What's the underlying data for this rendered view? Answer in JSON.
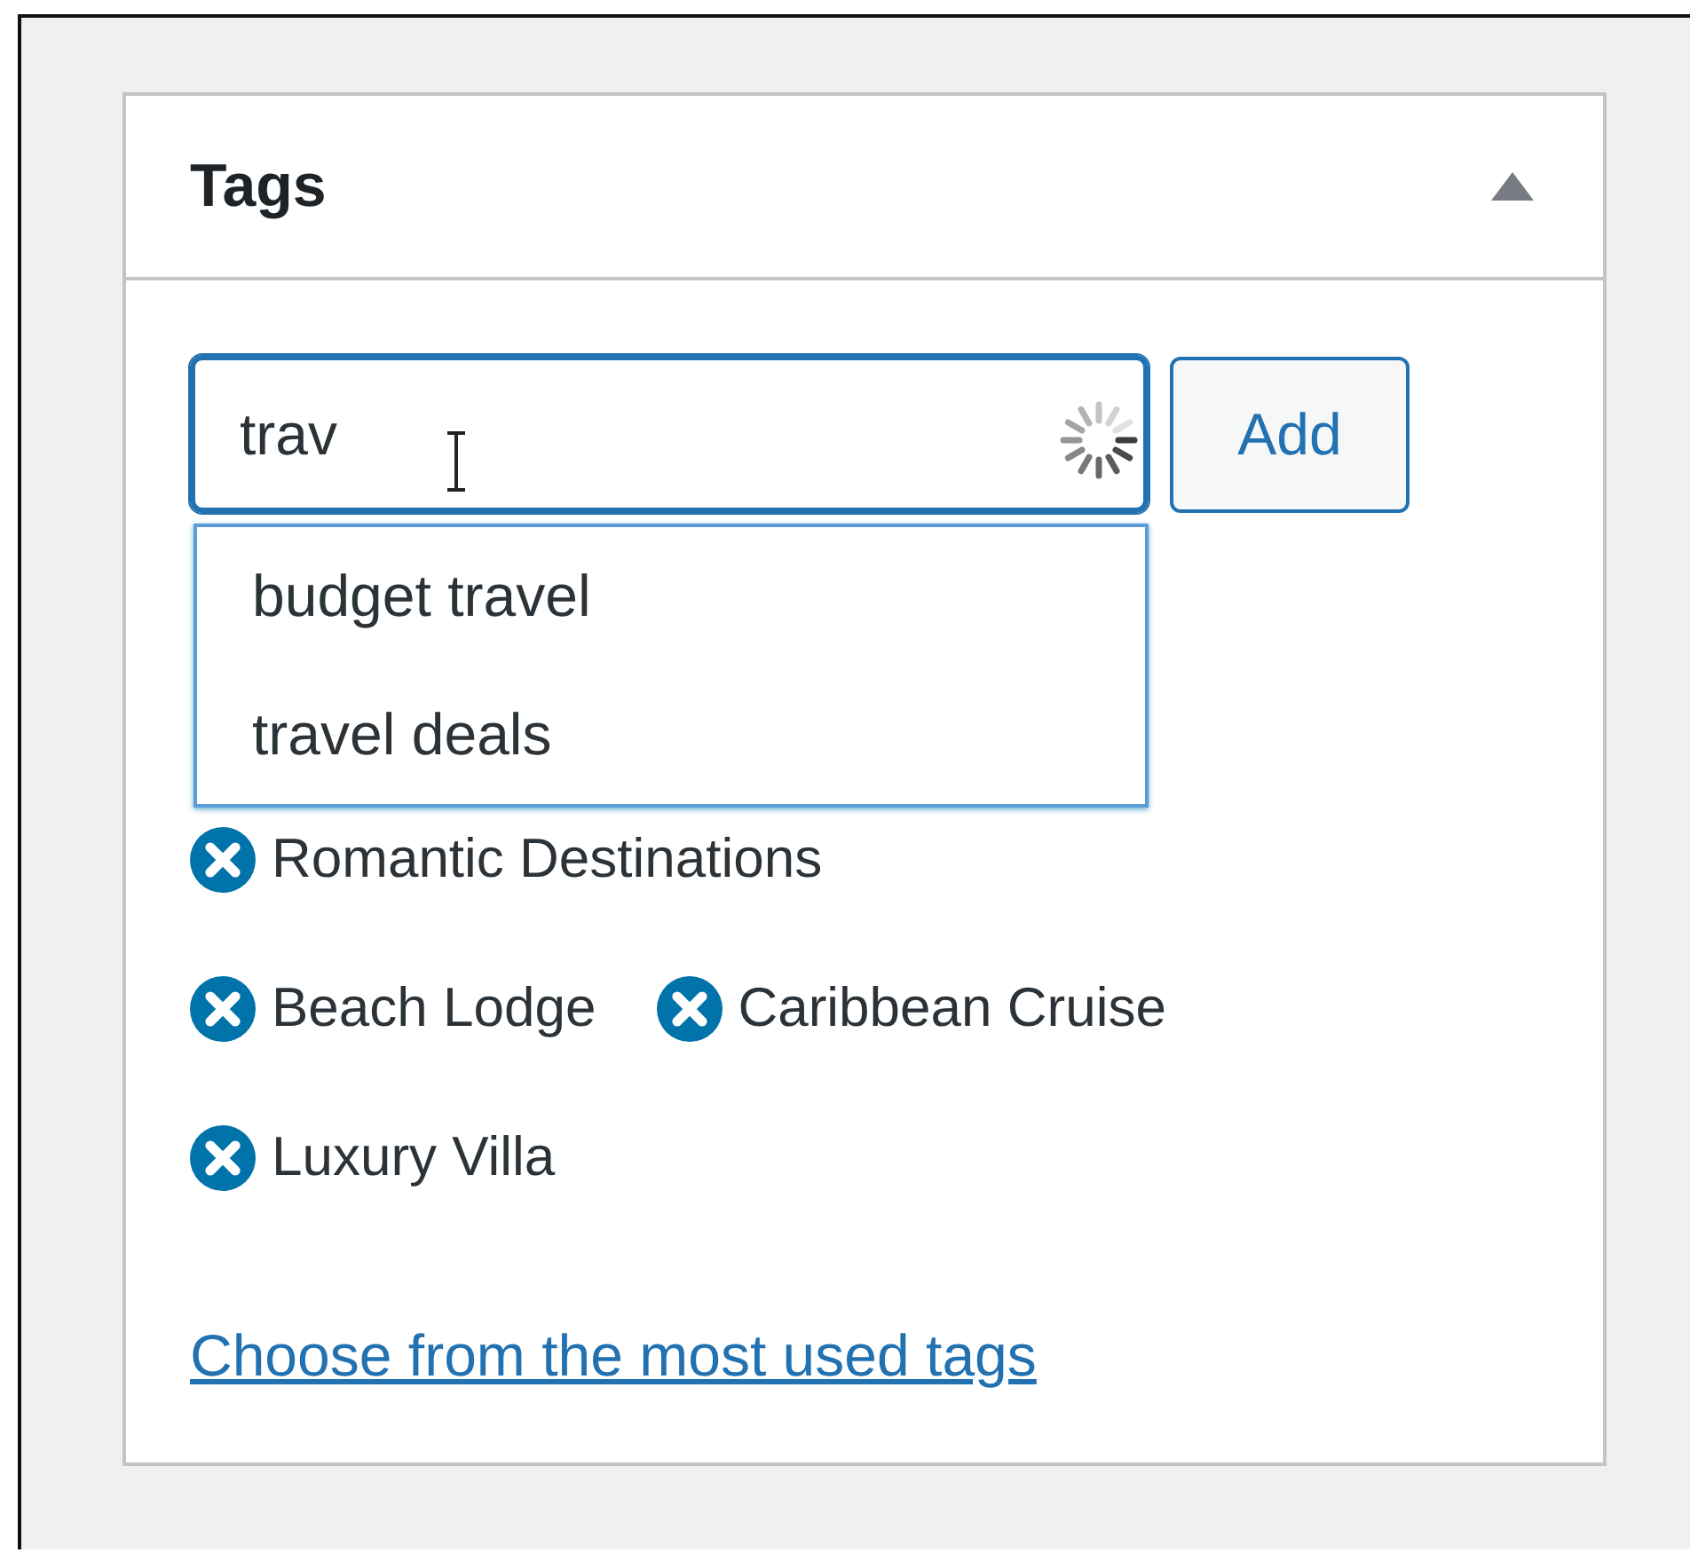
{
  "panel": {
    "title": "Tags",
    "expanded": true
  },
  "tag_input": {
    "value": "trav",
    "loading": true
  },
  "add_button": "Add",
  "suggestions": [
    {
      "label": "budget travel"
    },
    {
      "label": "travel deals"
    }
  ],
  "tags": [
    {
      "label": "Romantic Destinations"
    },
    {
      "label": "Beach Lodge"
    },
    {
      "label": "Caribbean Cruise"
    },
    {
      "label": "Luxury Villa"
    }
  ],
  "link": "Choose from the most used tags"
}
